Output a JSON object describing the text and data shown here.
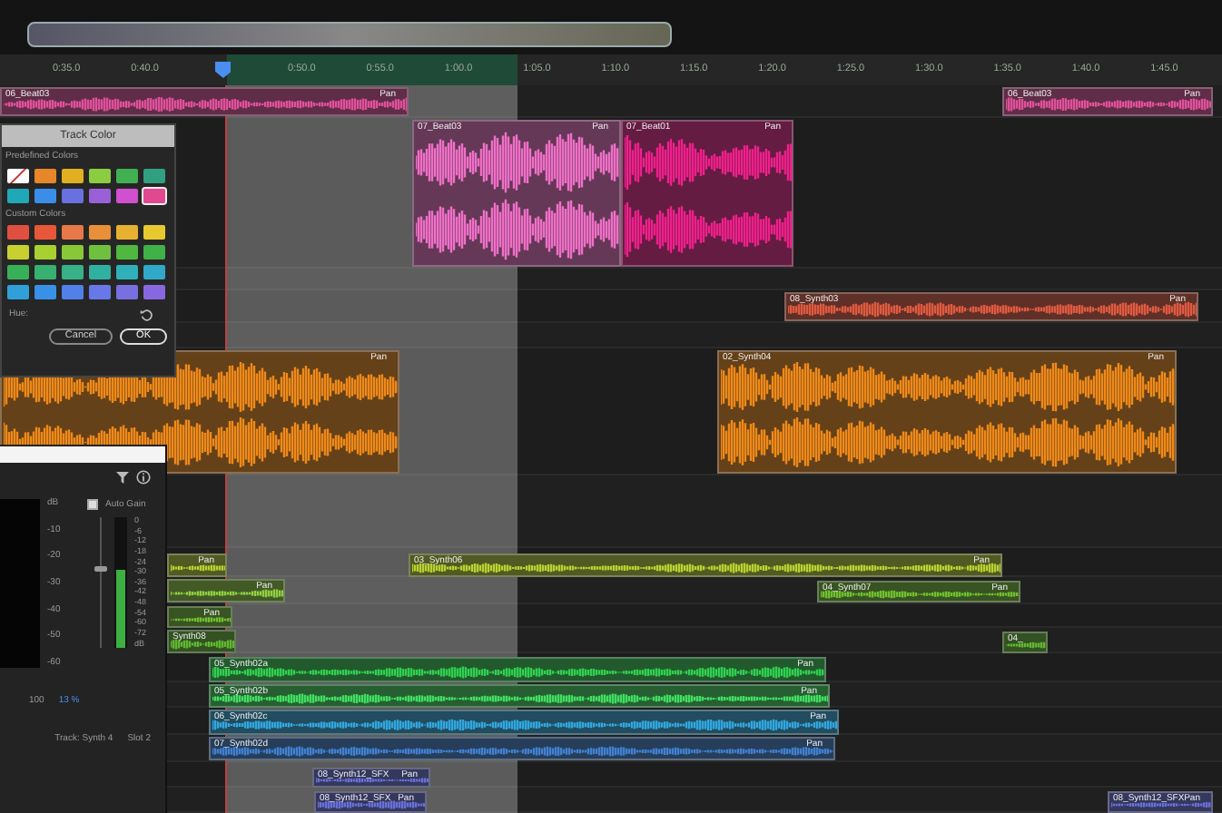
{
  "ruler": {
    "items": [
      {
        "kind": "tick",
        "label": "0:35.0"
      },
      {
        "kind": "tick",
        "label": "0:40.0"
      },
      {
        "kind": "playhead"
      },
      {
        "kind": "tick",
        "label": "0:50.0"
      },
      {
        "kind": "tick",
        "label": "0:55.0"
      },
      {
        "kind": "tick",
        "label": "1:00.0"
      },
      {
        "kind": "tick",
        "label": "1:05.0"
      },
      {
        "kind": "tick",
        "label": "1:10.0"
      },
      {
        "kind": "tick",
        "label": "1:15.0"
      },
      {
        "kind": "tick",
        "label": "1:20.0"
      },
      {
        "kind": "tick",
        "label": "1:25.0"
      },
      {
        "kind": "tick",
        "label": "1:30.0"
      },
      {
        "kind": "tick",
        "label": "1:35.0"
      },
      {
        "kind": "tick",
        "label": "1:40.0"
      },
      {
        "kind": "tick",
        "label": "1:45.0"
      }
    ]
  },
  "clips": [
    {
      "name": "06_Beat03",
      "pan_label": "Pan",
      "color": "#e0509a"
    },
    {
      "name": "06_Beat03",
      "pan_label": "Pan",
      "color": "#e0509a"
    },
    {
      "name": "07_Beat03",
      "pan_label": "Pan",
      "color": "#f070c8"
    },
    {
      "name": "07_Beat01",
      "pan_label": "Pan",
      "color": "#f0208c"
    },
    {
      "name": "08_Synth03",
      "pan_label": "Pan",
      "color": "#e05a40"
    },
    {
      "pan_label": "Pan",
      "color": "#f08a18"
    },
    {
      "name": "02_Synth04",
      "pan_label": "Pan",
      "color": "#f08a18"
    },
    {
      "pan_label": "Pan",
      "color": "#b8d030"
    },
    {
      "name": "03_Synth06",
      "pan_label": "Pan",
      "color": "#b8d030"
    },
    {
      "pan_label": "Pan",
      "color": "#90d040"
    },
    {
      "name": "04_Synth07",
      "pan_label": "Pan",
      "color": "#70c030"
    },
    {
      "pan_label": "Pan",
      "color": "#70c030"
    },
    {
      "name": "Synth08",
      "color": "#60b830"
    },
    {
      "name": "04_",
      "color": "#60b830"
    },
    {
      "name": "05_Synth02a",
      "pan_label": "Pan",
      "color": "#30d050"
    },
    {
      "name": "05_Synth02b",
      "pan_label": "Pan",
      "color": "#40e060"
    },
    {
      "name": "06_Synth02c",
      "pan_label": "Pan",
      "color": "#30a8e0"
    },
    {
      "name": "07_Synth02d",
      "pan_label": "Pan",
      "color": "#4080d0"
    },
    {
      "name": "08_Synth12_SFX",
      "pan_label": "Pan",
      "color": "#6870d8"
    },
    {
      "name": "08_Synth12_SFX",
      "pan_label": "Pan",
      "color": "#6870d8"
    },
    {
      "name": "08_Synth12_SFX",
      "pan_label": "Pan",
      "color": "#6870d8"
    }
  ],
  "track_color_dialog": {
    "title": "Track Color",
    "predefined_label": "Predefined Colors",
    "predefined": [
      {
        "kind": "none",
        "selected": false
      },
      {
        "kind": "swatch",
        "color": "#e8862a",
        "selected": false
      },
      {
        "kind": "swatch",
        "color": "#e0b020",
        "selected": false
      },
      {
        "kind": "swatch",
        "color": "#8ccc40",
        "selected": false
      },
      {
        "kind": "swatch",
        "color": "#40b050",
        "selected": false
      },
      {
        "kind": "swatch",
        "color": "#30a080",
        "selected": false
      },
      {
        "kind": "swatch",
        "color": "#20a8b8",
        "selected": false
      },
      {
        "kind": "swatch",
        "color": "#3a8ee8",
        "selected": false
      },
      {
        "kind": "swatch",
        "color": "#6a70e0",
        "selected": false
      },
      {
        "kind": "swatch",
        "color": "#9a60d8",
        "selected": false
      },
      {
        "kind": "swatch",
        "color": "#d050d0",
        "selected": false
      },
      {
        "kind": "swatch",
        "color": "#e04890",
        "selected": true
      }
    ],
    "custom_label": "Custom Colors",
    "custom": [
      {
        "color": "#e05040"
      },
      {
        "color": "#e85838"
      },
      {
        "color": "#e87848"
      },
      {
        "color": "#e89038"
      },
      {
        "color": "#e8b030"
      },
      {
        "color": "#e8c830"
      },
      {
        "color": "#c8d030"
      },
      {
        "color": "#a8d030"
      },
      {
        "color": "#88c838"
      },
      {
        "color": "#70c040"
      },
      {
        "color": "#50b840"
      },
      {
        "color": "#40b048"
      },
      {
        "color": "#38b058"
      },
      {
        "color": "#38b070"
      },
      {
        "color": "#38b088"
      },
      {
        "color": "#30b0a0"
      },
      {
        "color": "#30b0b8"
      },
      {
        "color": "#30a8c8"
      },
      {
        "color": "#30a0d8"
      },
      {
        "color": "#3890e8"
      },
      {
        "color": "#5080e8"
      },
      {
        "color": "#6878e8"
      },
      {
        "color": "#7870e0"
      },
      {
        "color": "#8868e0"
      }
    ],
    "hue_label": "Hue:",
    "buttons": [
      {
        "label": "Cancel",
        "default": false
      },
      {
        "label": "OK",
        "default": true
      }
    ]
  },
  "level_panel": {
    "db_scale": [
      "dB",
      "-10",
      "-20",
      "-30",
      "-40",
      "-50",
      "-60"
    ],
    "auto_gain": {
      "label": "Auto Gain",
      "checked": true
    },
    "gain_slider": {
      "level": 0.6
    },
    "meter": {
      "level": 0.6,
      "scale": [
        "0",
        "-6",
        "-12",
        "-18",
        "-24",
        "-30",
        "-36",
        "-42",
        "-48",
        "-54",
        "-60",
        "-72",
        "dB"
      ]
    },
    "x_label": "100",
    "percent_reading": "13 %",
    "track_label": "Track: Synth 4",
    "slot_label": "Slot 2"
  }
}
